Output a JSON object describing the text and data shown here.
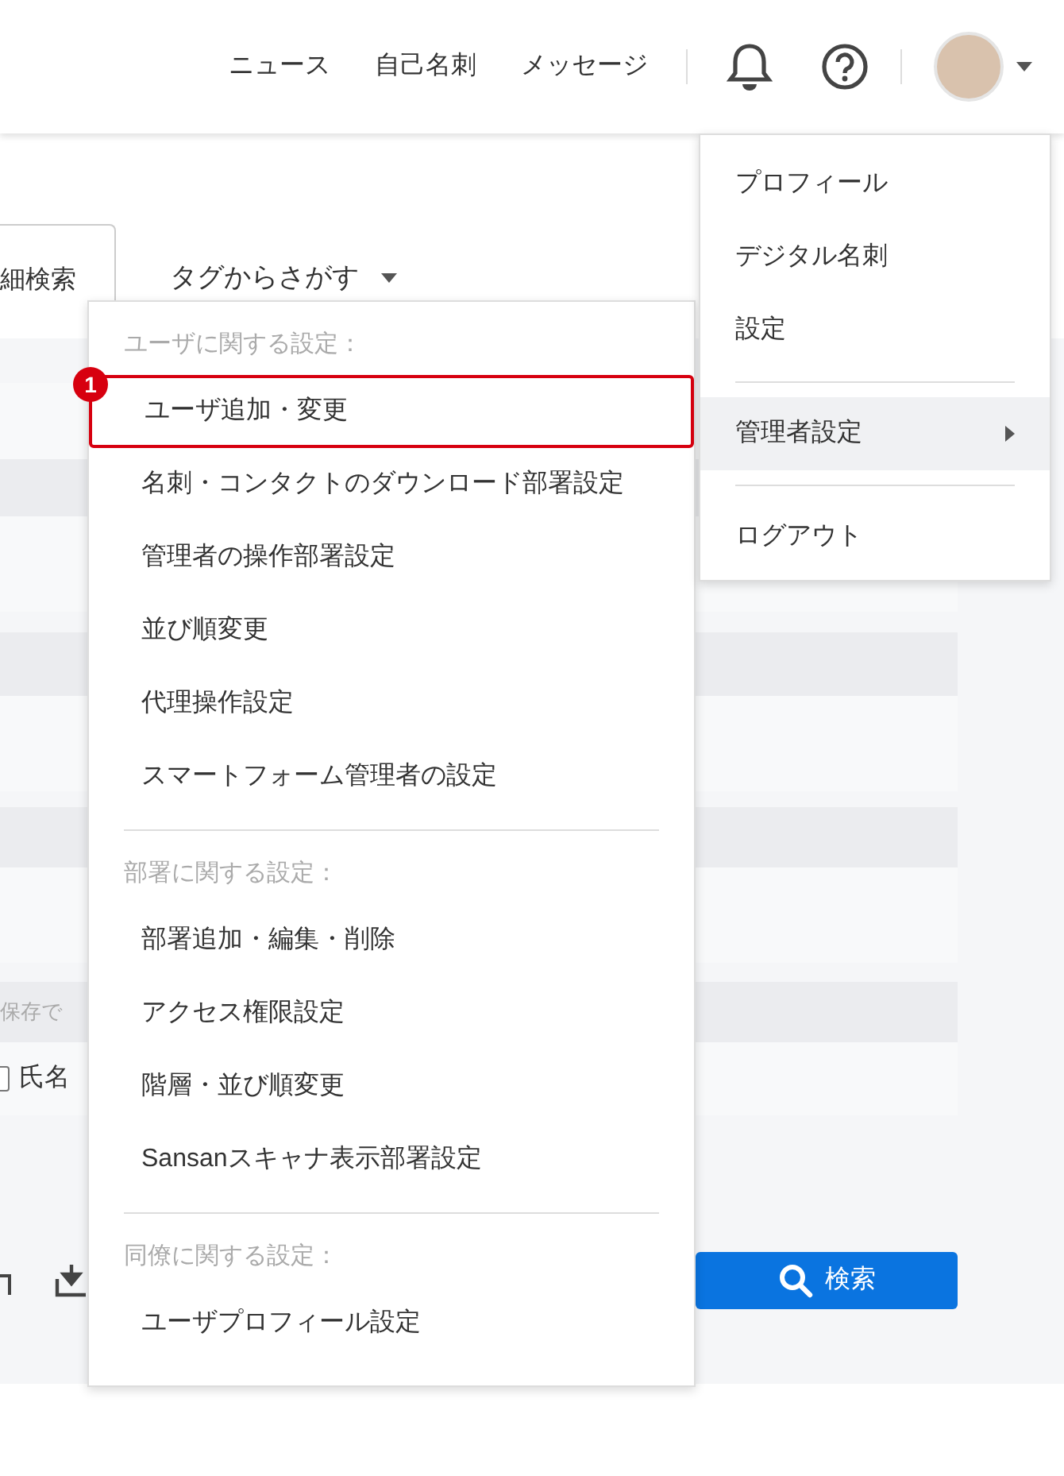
{
  "header": {
    "nav": [
      "ニュース",
      "自己名刺",
      "メッセージ"
    ]
  },
  "search_tabs": [
    {
      "label": "細検索",
      "selected": true
    },
    {
      "label": "タグからさがす",
      "selected": false
    }
  ],
  "hint": "保存で",
  "checkbox": {
    "label": "氏名",
    "checked": false
  },
  "search_button": "検索",
  "user_menu": {
    "groups": [
      [
        {
          "label": "プロフィール",
          "kind": "item",
          "selected": false
        },
        {
          "label": "デジタル名刺",
          "kind": "item",
          "selected": false
        },
        {
          "label": "設定",
          "kind": "item",
          "selected": false
        }
      ],
      [
        {
          "label": "管理者設定",
          "kind": "submenu",
          "selected": true
        }
      ],
      [
        {
          "label": "ログアウト",
          "kind": "item",
          "selected": false
        }
      ]
    ]
  },
  "admin_menu": {
    "sections": [
      {
        "heading": "ユーザに関する設定：",
        "items": [
          {
            "label": "ユーザ追加・変更",
            "callout": "1",
            "selected": true
          },
          {
            "label": "名刺・コンタクトのダウンロード部署設定",
            "selected": false
          },
          {
            "label": "管理者の操作部署設定",
            "selected": false
          },
          {
            "label": "並び順変更",
            "selected": false
          },
          {
            "label": "代理操作設定",
            "selected": false
          },
          {
            "label": "スマートフォーム管理者の設定",
            "selected": false
          }
        ]
      },
      {
        "heading": "部署に関する設定：",
        "items": [
          {
            "label": "部署追加・編集・削除",
            "selected": false
          },
          {
            "label": "アクセス権限設定",
            "selected": false
          },
          {
            "label": "階層・並び順変更",
            "selected": false
          },
          {
            "label": "Sansanスキャナ表示部署設定",
            "selected": false
          }
        ]
      },
      {
        "heading": "同僚に関する設定：",
        "items": [
          {
            "label": "ユーザプロフィール設定",
            "selected": false
          }
        ]
      }
    ]
  }
}
